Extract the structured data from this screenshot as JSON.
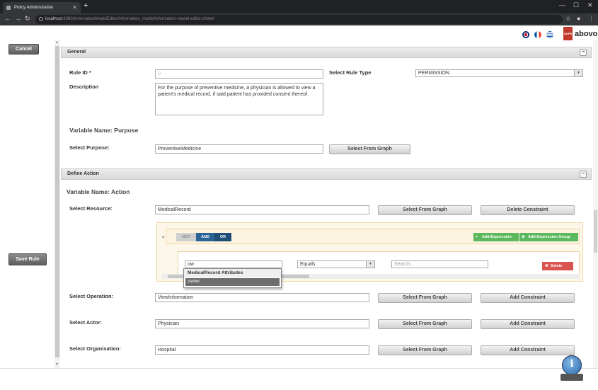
{
  "browser": {
    "tab_title": "Policy Administration",
    "tab_close": "✕",
    "new_tab": "+",
    "url_host": "localhost",
    "url_path": ":8080/InformationModelEditor/information_model/information-model-editor.xhtml#"
  },
  "header": {
    "gdpr_label": "GDPR",
    "brand": "abovo",
    "languages": [
      "English",
      "French",
      "Greek"
    ]
  },
  "left": {
    "cancel_label": "Cancel",
    "save_label": "Save Rule"
  },
  "general": {
    "title": "General",
    "collapse": "−",
    "rule_id_label": "Rule ID *",
    "rule_id_value": "0",
    "rule_type_label": "Select Rule Type",
    "rule_type_value": "PERMISSION",
    "description_label": "Description",
    "description_value": "For the purpose of preventive medicine, a physician is allowed to view a patient's medical record, if said patient has provided consent thereof.",
    "variable_heading": "Variable Name: Purpose",
    "purpose_label": "Select Purpose:",
    "purpose_value": "PreventiveMedicine",
    "select_from_graph": "Select From Graph"
  },
  "action": {
    "title": "Define Action",
    "collapse": "−",
    "variable_heading": "Variable Name: Action",
    "resource_label": "Select Resource:",
    "resource_value": "MedicalRecord",
    "select_from_graph": "Select From Graph",
    "delete_constraint": "Delete Constraint",
    "add_constraint": "Add Constraint",
    "query": {
      "not_label": "NOT",
      "and_label": "AND",
      "or_label": "OR",
      "add_expression": "Add Expression",
      "add_expression_group": "Add Expression Group",
      "field_value": "ow",
      "operator_value": "Equals",
      "search_placeholder": "Search...",
      "delete_label": "Delete",
      "dropdown_group": "MedicalRecord Attributes",
      "dropdown_option": "owner"
    },
    "operation_label": "Select Operation:",
    "operation_value": "ViewInformation",
    "actor_label": "Select Actor:",
    "actor_value": "Physician",
    "organisation_label": "Select Organisation:",
    "organisation_value": "Hospital"
  },
  "colors": {
    "and_or_active": "#2a6496",
    "green": "#5cb85c",
    "red": "#d9534f"
  }
}
